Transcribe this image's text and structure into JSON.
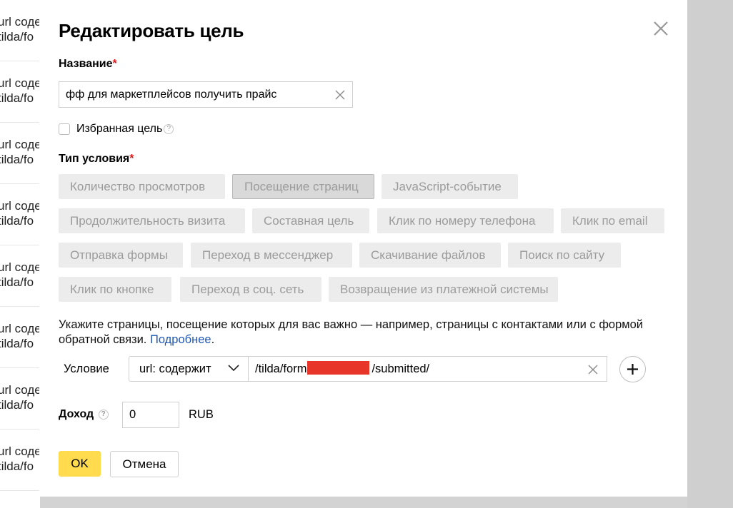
{
  "background": {
    "rows": [
      {
        "line1": "url соде",
        "line2": "tilda/fo"
      },
      {
        "line1": "url соде",
        "line2": "tilda/fo"
      },
      {
        "line1": "url соде",
        "line2": "tilda/fo"
      },
      {
        "line1": "url соде",
        "line2": "tilda/fo"
      },
      {
        "line1": "url соде",
        "line2": "tilda/fo"
      },
      {
        "line1": "url соде",
        "line2": "tilda/fo"
      },
      {
        "line1": "url соде",
        "line2": "tilda/fo"
      },
      {
        "line1": "url соде",
        "line2": "tilda/fo"
      }
    ]
  },
  "modal": {
    "title": "Редактировать цель",
    "close_icon": "close-icon",
    "name": {
      "label": "Название",
      "required_mark": "*",
      "value": "фф для маркетплейсов получить прайс"
    },
    "favorite": {
      "label": "Избранная цель",
      "checked": false,
      "help_glyph": "?"
    },
    "condition_type": {
      "label": "Тип условия",
      "required_mark": "*",
      "options": [
        "Количество просмотров",
        "Посещение страниц",
        "JavaScript-событие",
        "Продолжительность визита",
        "Составная цель",
        "Клик по номеру телефона",
        "Клик по email",
        "Отправка формы",
        "Переход в мессенджер",
        "Скачивание файлов",
        "Поиск по сайту",
        "Клик по кнопке",
        "Переход в соц. сеть",
        "Возвращение из платежной системы"
      ],
      "selected": "Посещение страниц"
    },
    "description": {
      "text": "Укажите страницы, посещение которых для вас важно — например, страницы с контактами или с формой обратной связи.",
      "link": "Подробнее",
      "end": "."
    },
    "condition": {
      "label": "Условие",
      "operator": "url: содержит",
      "value_prefix": "/tilda/form",
      "value_suffix": "/submitted/"
    },
    "income": {
      "label": "Доход",
      "help_glyph": "?",
      "value": "0",
      "currency": "RUB"
    },
    "buttons": {
      "ok": "OK",
      "cancel": "Отмена"
    }
  },
  "colors": {
    "accent_yellow": "#ffdb4d",
    "required_red": "#e0171b",
    "link_blue": "#1e56b8",
    "redaction": "#e8352a"
  }
}
